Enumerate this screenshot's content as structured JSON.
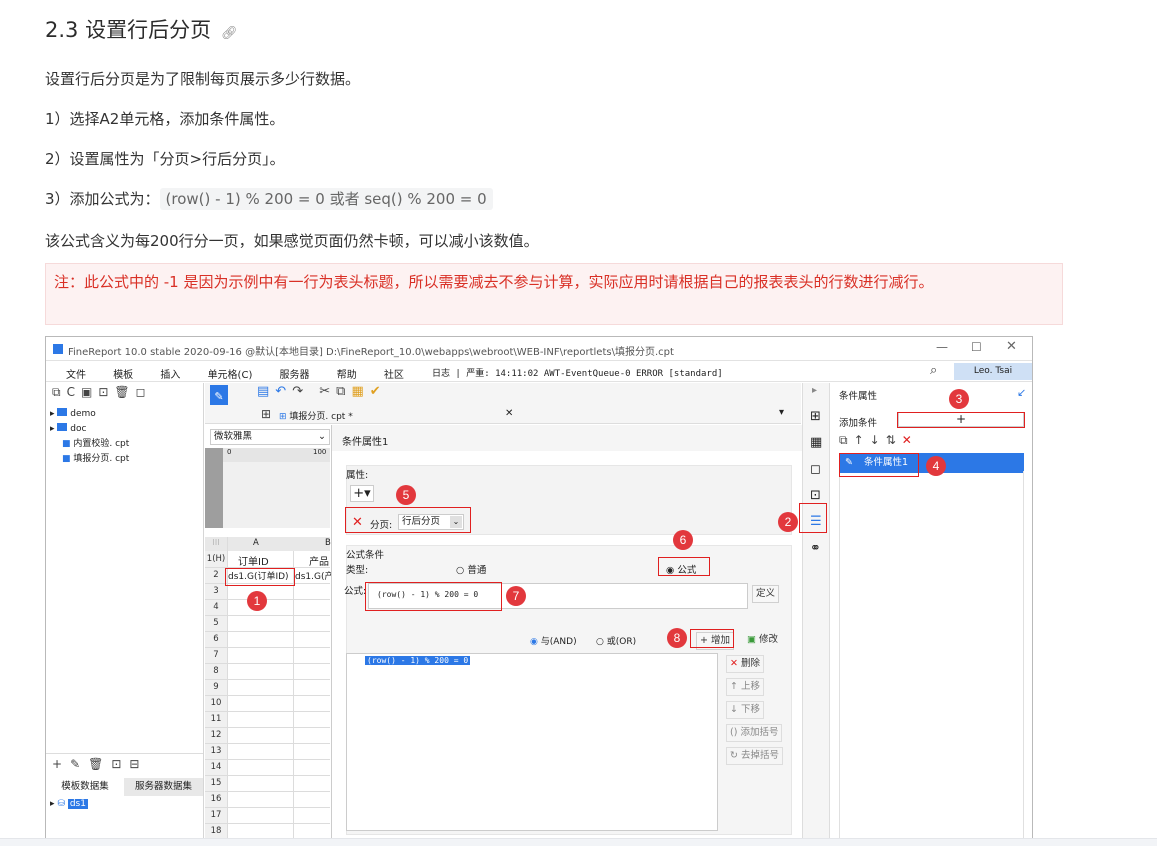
{
  "doc": {
    "heading": "2.3 设置行后分页",
    "heading_link_icon": "link-icon",
    "p1": "设置行后分页是为了限制每页展示多少行数据。",
    "step1": "1）选择A2单元格，添加条件属性。",
    "step2": "2）设置属性为「分页>行后分页」。",
    "step3_prefix": "3）添加公式为：",
    "step3_code": "(row() - 1) % 200 = 0 或者 seq() % 200 = 0",
    "p2": "该公式含义为每200行分一页，如果感觉页面仍然卡顿，可以减小该数值。",
    "note": "注：此公式中的 -1 是因为示例中有一行为表头标题，所以需要减去不参与计算，实际应用时请根据自己的报表表头的行数进行减行。"
  },
  "app": {
    "title": "FineReport 10.0 stable 2020-09-16 @默认[本地目录]   D:\\FineReport_10.0\\webapps\\webroot\\WEB-INF\\reportlets\\填报分页.cpt",
    "menu": [
      "文件",
      "模板",
      "插入",
      "单元格(C)",
      "服务器",
      "帮助",
      "社区"
    ],
    "log": "日志 | 严重: 14:11:02 AWT-EventQueue-0 ERROR [standard]",
    "user": "Leo. Tsai",
    "tree": [
      {
        "label": "demo",
        "type": "folder"
      },
      {
        "label": "doc",
        "type": "folder"
      },
      {
        "label": "内置校验. cpt",
        "type": "file"
      },
      {
        "label": "填报分页. cpt",
        "type": "file"
      }
    ],
    "tab_title": "填报分页. cpt *",
    "font_select": "微软雅黑",
    "ruler_0": "0",
    "ruler_100": "100",
    "col_a": "A",
    "col_b": "B",
    "row1_label": "1(H)",
    "cell_a1": "订单ID",
    "cell_b1": "产品",
    "cell_a2": "ds1.G(订单ID)",
    "cell_b2": "ds1.G(产",
    "rows": [
      "1(H)",
      "2",
      "3",
      "4",
      "5",
      "6",
      "7",
      "8",
      "9",
      "10",
      "11",
      "12",
      "13",
      "14",
      "15",
      "16",
      "17",
      "18"
    ],
    "dataset_tabs": [
      "模板数据集",
      "服务器数据集"
    ],
    "dataset_item": "ds1",
    "dialog": {
      "title": "条件属性1",
      "attr_label": "属性:",
      "page_label": "分页:",
      "page_value": "行后分页",
      "formula_cond": "公式条件",
      "type_label": "类型:",
      "type_normal": "普通",
      "type_formula": "公式",
      "formula_label": "公式:",
      "formula_value": "(row() - 1) % 200 = 0",
      "define_btn": "定义",
      "and_label": "与(AND)",
      "or_label": "或(OR)",
      "add_btn": "增加",
      "modify_btn": "修改",
      "list_item": "(row() - 1) % 200 = 0",
      "delete_btn": "删除",
      "up_btn": "上移",
      "down_btn": "下移",
      "add_bracket_btn": "添加括号",
      "remove_bracket_btn": "去掉括号"
    },
    "right_panel": {
      "title": "条件属性",
      "add_cond": "添加条件",
      "item": "条件属性1"
    },
    "badges": [
      "1",
      "2",
      "3",
      "4",
      "5",
      "6",
      "7",
      "8"
    ]
  }
}
